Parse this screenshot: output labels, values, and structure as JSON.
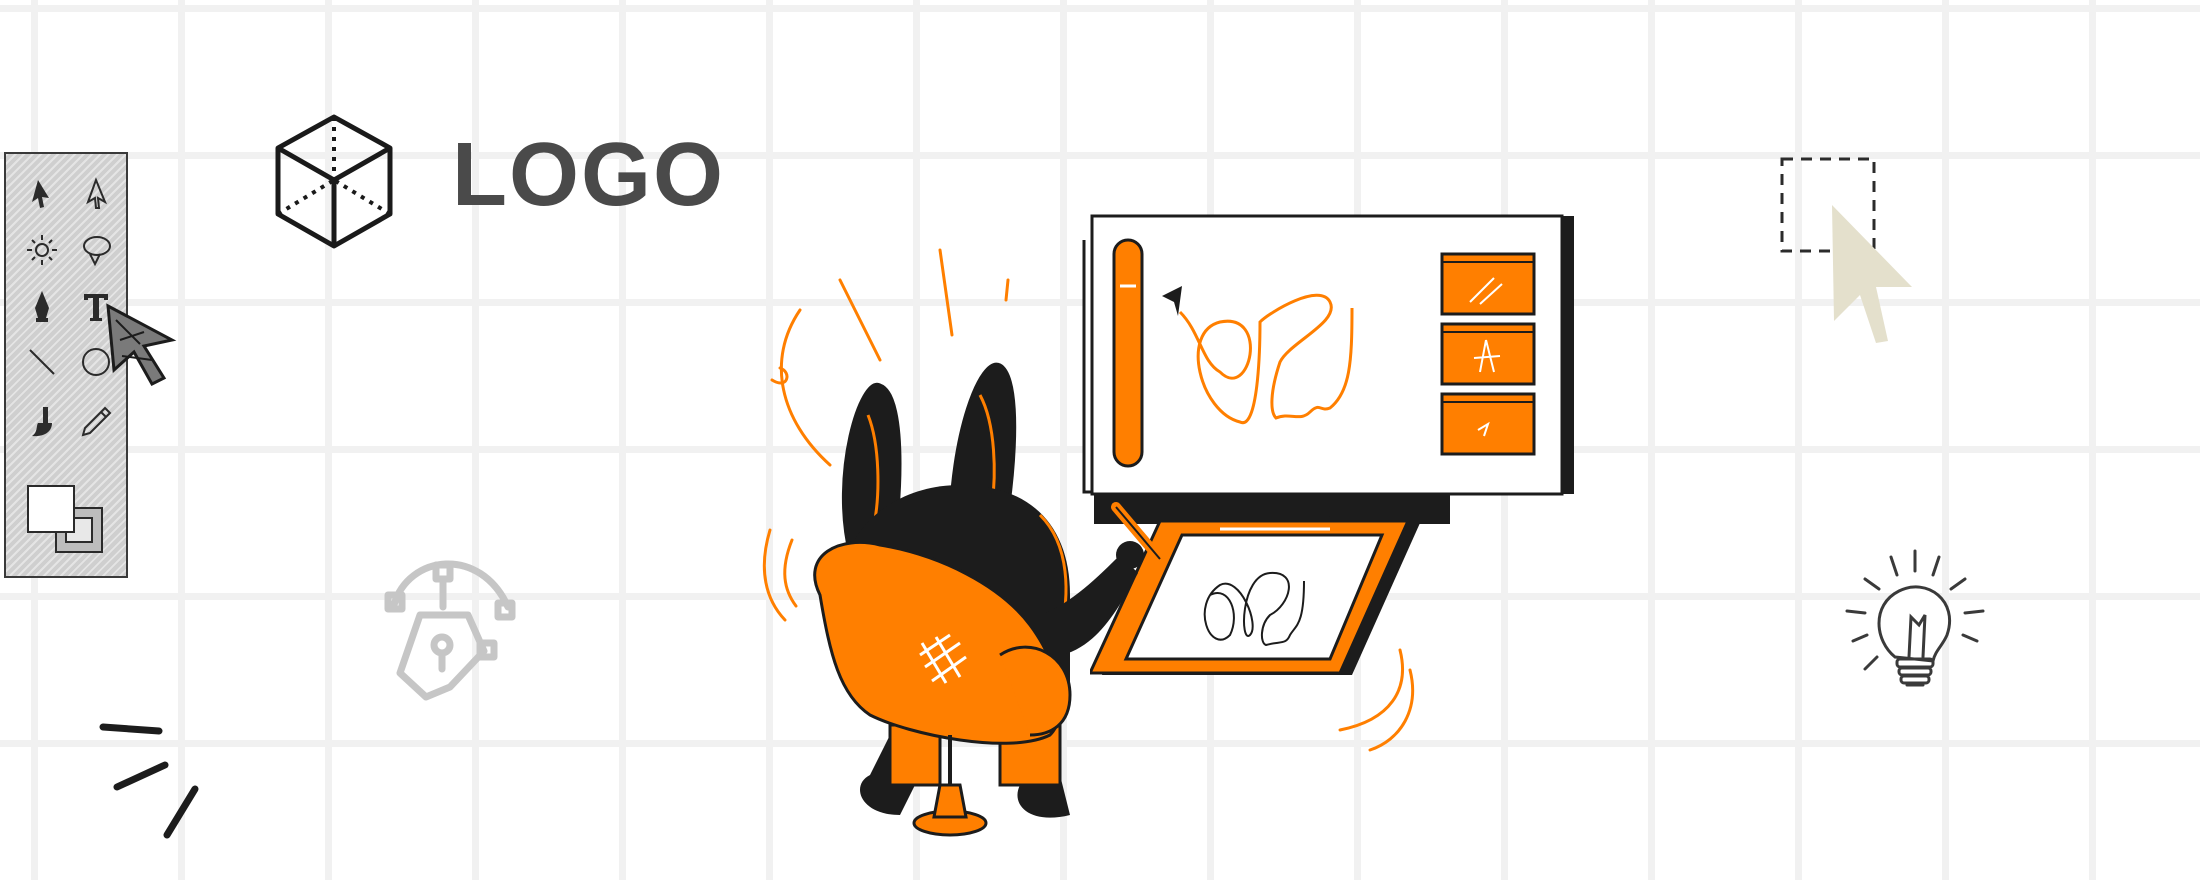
{
  "logo": {
    "text": "LOGO",
    "icon": "cube-icon"
  },
  "toolbox": {
    "tools": [
      {
        "icon": "selection-arrow-icon"
      },
      {
        "icon": "direct-selection-arrow-icon"
      },
      {
        "icon": "sun-adjust-icon"
      },
      {
        "icon": "lasso-icon"
      },
      {
        "icon": "pen-tool-icon"
      },
      {
        "icon": "text-tool-icon"
      },
      {
        "icon": "line-tool-icon"
      },
      {
        "icon": "ellipse-tool-icon"
      },
      {
        "icon": "brush-tool-icon"
      },
      {
        "icon": "pencil-tool-icon"
      },
      {
        "icon": "color-swatches-icon"
      }
    ]
  },
  "decorations": {
    "bezier_pen": "bezier-pen-icon",
    "selection_cursor": "marquee-cursor-icon",
    "lightbulb": "lightbulb-icon",
    "character": "designer-character-illustration"
  },
  "colors": {
    "accent": "#FF7F00",
    "ink": "#1c1c1c",
    "logo_text": "#4a4a4a",
    "grid": "#f1f1f1",
    "toolbox_bg": "#cfcfcf",
    "cursor_tint": "#e4e0cc"
  }
}
